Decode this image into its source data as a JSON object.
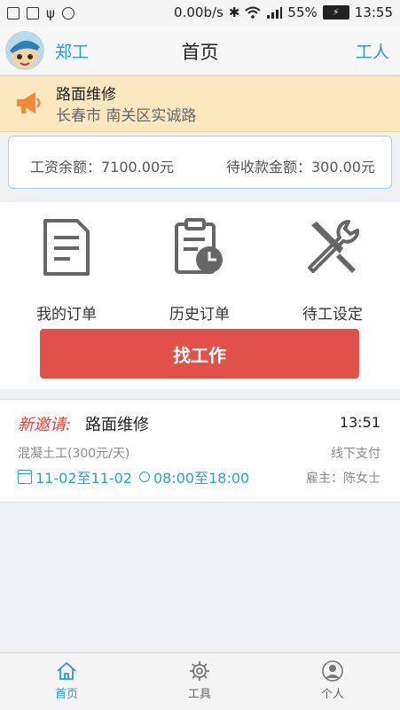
{
  "status_bar": {
    "network_speed": "0.00b/s",
    "battery_percent": "55%",
    "time": "13:55"
  },
  "header": {
    "username": "郑工",
    "title": "首页",
    "role_label": "工人"
  },
  "notice": {
    "title": "路面维修",
    "location": "长春市 南关区实诚路"
  },
  "balance": {
    "wage_label": "工资余额：7100.00元",
    "receivable_label": "待收款金额：300.00元"
  },
  "menu": {
    "items": [
      {
        "label": "我的订单",
        "icon": "document-icon"
      },
      {
        "label": "历史订单",
        "icon": "clipboard-clock-icon"
      },
      {
        "label": "待工设定",
        "icon": "tools-icon"
      }
    ],
    "find_job_label": "找工作"
  },
  "invitation": {
    "tag": "新邀请:",
    "title": "路面维修",
    "time": "13:51",
    "work_type": "混凝土工(300元/天)",
    "payment": "线下支付",
    "date_range": "11-02至11-02",
    "time_range": "08:00至18:00",
    "employer": "雇主：陈女士"
  },
  "tabbar": {
    "items": [
      {
        "label": "首页",
        "icon": "home-icon",
        "active": true
      },
      {
        "label": "工具",
        "icon": "gear-icon",
        "active": false
      },
      {
        "label": "个人",
        "icon": "person-icon",
        "active": false
      }
    ]
  },
  "colors": {
    "accent": "#2a9ad6",
    "button": "#e2504a",
    "notice_bg": "#fbe8be",
    "invite_tag": "#e0413a"
  }
}
